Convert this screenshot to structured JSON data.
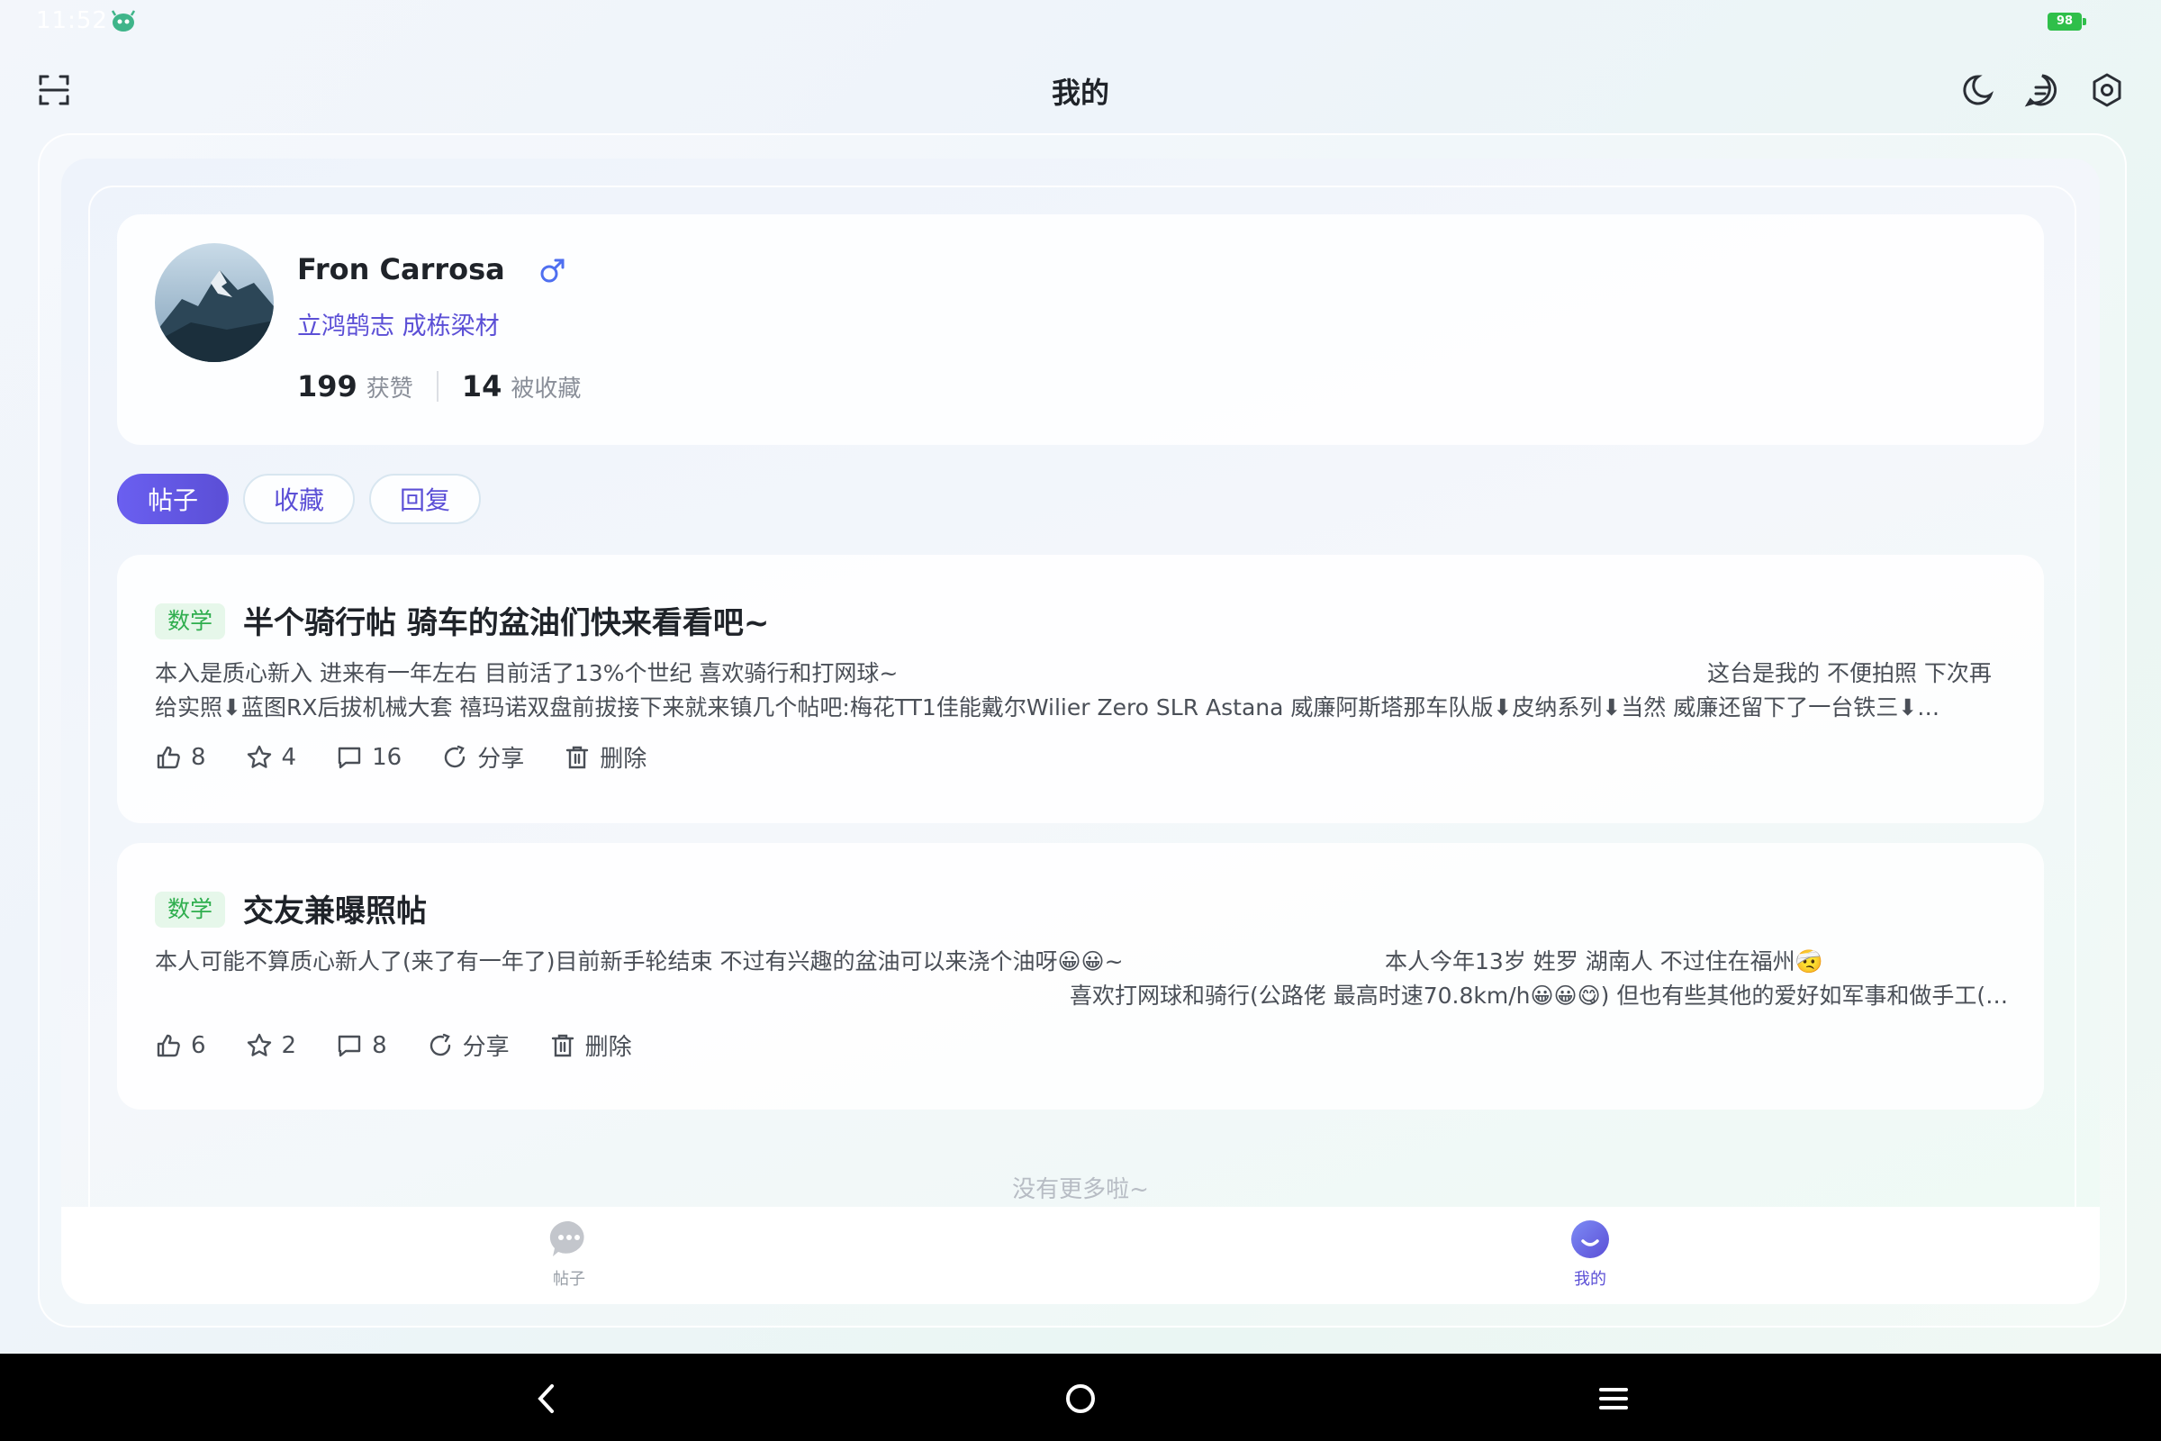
{
  "status_bar": {
    "time": "11:52",
    "battery": "98"
  },
  "header": {
    "title": "我的"
  },
  "profile": {
    "name": "Fron Carrosa",
    "motto": "立鸿鹄志 成栋梁材",
    "likes_count": "199",
    "likes_label": "获赞",
    "favorited_count": "14",
    "favorited_label": "被收藏"
  },
  "tabs": [
    "帖子",
    "收藏",
    "回复"
  ],
  "posts": [
    {
      "tag": "数学",
      "title": "半个骑行帖 骑车的盆油们快来看看吧~",
      "line1_left": "本入是质心新入 进来有一年左右 目前活了13%个世纪 喜欢骑行和打网球~",
      "line1_right": "这台是我的 不便拍照 下次再",
      "line2": "给实照⬇蓝图RX后拔机械大套 禧玛诺双盘前拔接下来就来镇几个帖吧:梅花TT1佳能戴尔Wilier Zero SLR Astana 威廉阿斯塔那车队版⬇皮纳系列⬇当然 威廉还留下了一台铁三⬇…",
      "likes": "8",
      "favorites": "4",
      "comments": "16",
      "share": "分享",
      "delete": "删除"
    },
    {
      "tag": "数学",
      "title": "交友兼曝照帖",
      "line1_left": "本人可能不算质心新人了(来了有一年了)目前新手轮结束 不过有兴趣的盆油可以来浇个油呀😀😀~",
      "line1_right": "本人今年13岁 姓罗   湖南人 不过住在福州🤕",
      "line2": "喜欢打网球和骑行(公路佬 最高时速70.8km/h😀😀😋) 但也有些其他的爱好如军事和做手工(…",
      "likes": "6",
      "favorites": "2",
      "comments": "8",
      "share": "分享",
      "delete": "删除"
    }
  ],
  "footer_text": "没有更多啦~",
  "bottom_nav": {
    "posts_label": "帖子",
    "mine_label": "我的"
  },
  "colors": {
    "accent": "#5b4fd6",
    "tag_green": "#2fae4e",
    "battery": "#2fbf4a"
  },
  "icons": [
    "scan-icon",
    "moon-icon",
    "message-icon",
    "settings-icon",
    "male-icon",
    "like-icon",
    "star-icon",
    "comment-icon",
    "share-icon",
    "trash-icon",
    "back-icon",
    "home-icon",
    "menu-icon"
  ]
}
